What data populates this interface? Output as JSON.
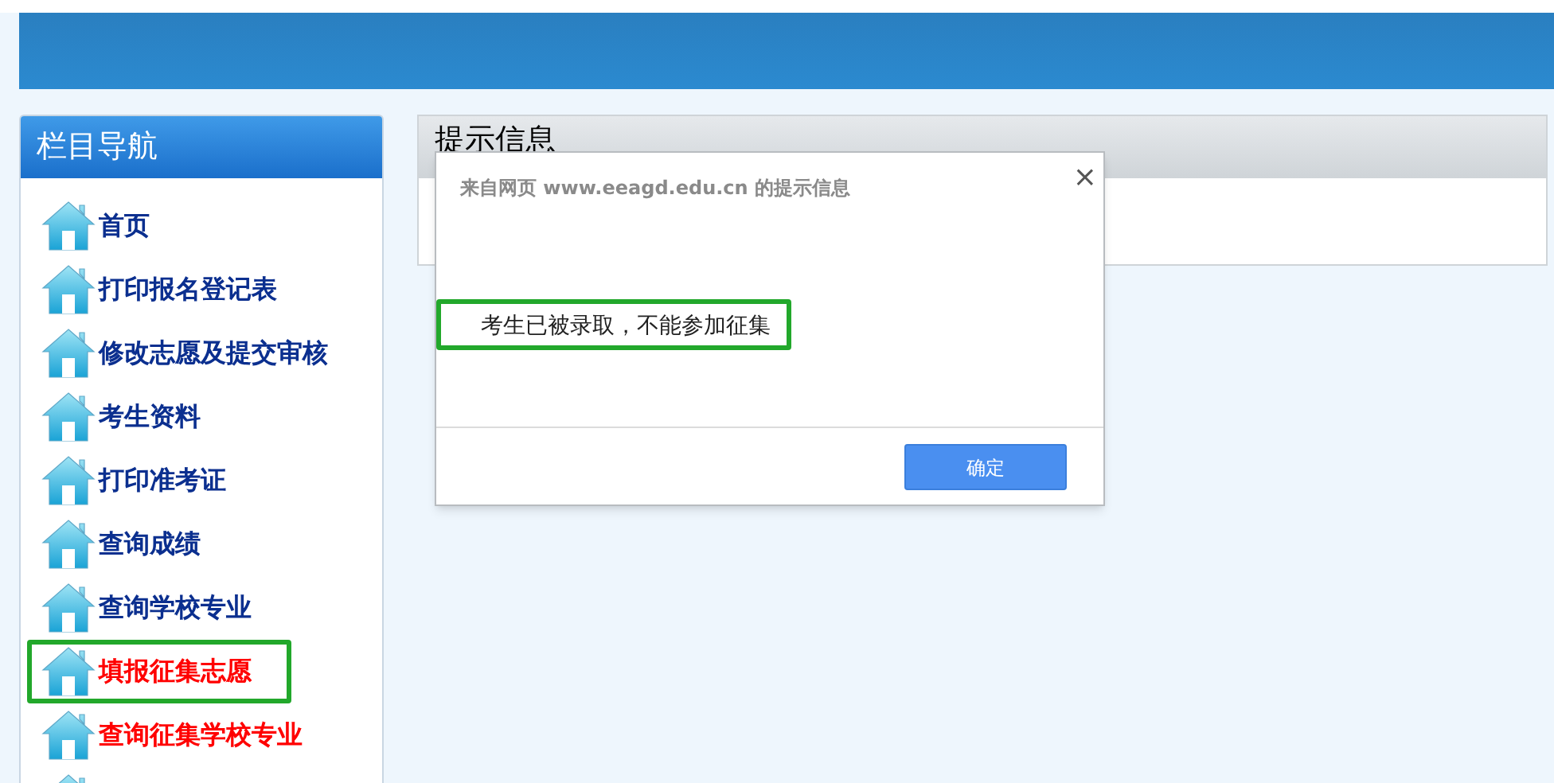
{
  "sidebar": {
    "title": "栏目导航",
    "items": [
      {
        "label": "首页",
        "color": "#0b2f8f",
        "highlighted": false
      },
      {
        "label": "打印报名登记表",
        "color": "#0b2f8f",
        "highlighted": false
      },
      {
        "label": "修改志愿及提交审核",
        "color": "#0b2f8f",
        "highlighted": false
      },
      {
        "label": "考生资料",
        "color": "#0b2f8f",
        "highlighted": false
      },
      {
        "label": "打印准考证",
        "color": "#0b2f8f",
        "highlighted": false
      },
      {
        "label": "查询成绩",
        "color": "#0b2f8f",
        "highlighted": false
      },
      {
        "label": "查询学校专业",
        "color": "#0b2f8f",
        "highlighted": false
      },
      {
        "label": "填报征集志愿",
        "color": "#ff0000",
        "highlighted": true
      },
      {
        "label": "查询征集学校专业",
        "color": "#ff0000",
        "highlighted": false
      }
    ]
  },
  "panel": {
    "title": "提示信息"
  },
  "dialog": {
    "title": "来自网页 www.eeagd.edu.cn 的提示信息",
    "close": "×",
    "message": "考生已被录取，不能参加征集",
    "message_highlighted": true,
    "button": "确定"
  }
}
